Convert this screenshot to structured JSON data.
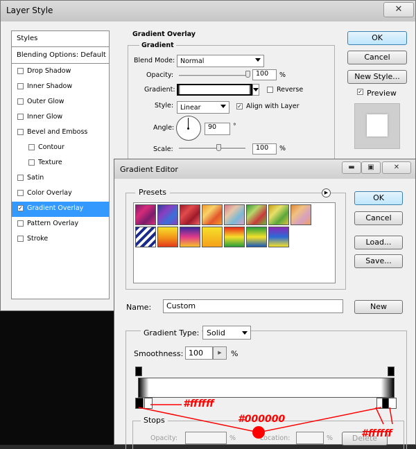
{
  "layer_style": {
    "title": "Layer Style",
    "close": "✕",
    "styles_header": "Styles",
    "blending_options": "Blending Options: Default",
    "items": [
      {
        "label": "Drop Shadow",
        "checked": false
      },
      {
        "label": "Inner Shadow",
        "checked": false
      },
      {
        "label": "Outer Glow",
        "checked": false
      },
      {
        "label": "Inner Glow",
        "checked": false
      },
      {
        "label": "Bevel and Emboss",
        "checked": false
      },
      {
        "label": "Contour",
        "checked": false
      },
      {
        "label": "Texture",
        "checked": false
      },
      {
        "label": "Satin",
        "checked": false
      },
      {
        "label": "Color Overlay",
        "checked": false
      },
      {
        "label": "Gradient Overlay",
        "checked": true
      },
      {
        "label": "Pattern Overlay",
        "checked": false
      },
      {
        "label": "Stroke",
        "checked": false
      }
    ],
    "section_title": "Gradient Overlay",
    "group_title": "Gradient",
    "blend_mode_label": "Blend Mode:",
    "blend_mode_value": "Normal",
    "opacity_label": "Opacity:",
    "opacity_value": "100",
    "opacity_unit": "%",
    "gradient_label": "Gradient:",
    "reverse_label": "Reverse",
    "style_label": "Style:",
    "style_value": "Linear",
    "align_label": "Align with Layer",
    "angle_label": "Angle:",
    "angle_value": "90",
    "angle_unit": "°",
    "scale_label": "Scale:",
    "scale_value": "100",
    "scale_unit": "%",
    "ok": "OK",
    "cancel": "Cancel",
    "new_style": "New Style...",
    "preview": "Preview",
    "opacity_fraction": 1.0,
    "scale_fraction": 0.6
  },
  "gradient_editor": {
    "title": "Gradient Editor",
    "minimize": "▬",
    "maximize": "▣",
    "close": "✕",
    "presets_label": "Presets",
    "ok": "OK",
    "cancel": "Cancel",
    "load": "Load...",
    "save": "Save...",
    "name_label": "Name:",
    "name_value": "Custom",
    "new_btn": "New",
    "gradient_type_label": "Gradient Type:",
    "gradient_type_value": "Solid",
    "smoothness_label": "Smoothness:",
    "smoothness_value": "100",
    "smoothness_unit": "%",
    "stops_label": "Stops",
    "opacity_label": "Opacity:",
    "opacity_unit": "%",
    "location_label": "Location:",
    "location_unit": "%",
    "delete_label": "Delete",
    "presets": [
      "linear-gradient(135deg,#7a1d6c,#d62b7a,#7a1d6c,#d62b7a)",
      "linear-gradient(135deg,#2e3f9e,#8a3dbf,#3b6fd9,#8a3dbf)",
      "linear-gradient(135deg,#9e1a2a,#e24b4b,#9e1a2a,#f06060)",
      "linear-gradient(135deg,#f39a2a,#f7d26a,#e2572b,#f39a2a)",
      "linear-gradient(135deg,#d67a8a,#e6c6a8,#7ab8d6,#d6a0c0)",
      "linear-gradient(135deg,#3a9a3a,#b6d66a,#c83a3a,#6ab63a)",
      "linear-gradient(135deg,#c8a01a,#e8e06a,#5aa83a,#d8c040)",
      "linear-gradient(135deg,#e08a3a,#f0c080,#d6a0c0,#f0a060)",
      "repeating-linear-gradient(135deg,#1a2a8a 0 4px,#ffffff 4px 8px)",
      "linear-gradient(180deg,#f5e02a,#f39a1a,#e23a1a)",
      "linear-gradient(180deg,#3a2a9e,#e23a8a,#f5c02a)",
      "linear-gradient(180deg,#f5e02a,#f5a01a)",
      "linear-gradient(180deg,#e82a1a,#f5e02a,#2a9e3a)",
      "linear-gradient(180deg,#2a9e3a,#f5e02a,#1a5ab6)",
      "linear-gradient(180deg,#8a2ab6,#2a6ad6,#f5e02a)"
    ]
  },
  "annotations": {
    "white_left": "#ffffff",
    "black_center": "#000000",
    "white_right": "#ffffff"
  },
  "colors": {
    "annotation": "#ff0000",
    "selection": "#3399ff"
  }
}
